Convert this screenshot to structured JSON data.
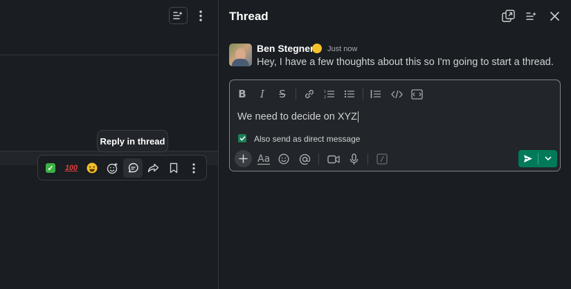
{
  "left_pane": {
    "tooltip": "Reply in thread",
    "actions": [
      {
        "name": "react-check-button",
        "icon": "white-check-mark-emoji"
      },
      {
        "name": "react-100-button",
        "icon": "hundred-points-emoji",
        "text": "100"
      },
      {
        "name": "react-laughing-button",
        "icon": "laughing-emoji"
      },
      {
        "name": "add-reaction-button",
        "icon": "add-reaction-icon"
      },
      {
        "name": "reply-in-thread-button",
        "icon": "reply-thread-icon"
      },
      {
        "name": "forward-message-button",
        "icon": "share-forward-icon"
      },
      {
        "name": "save-for-later-button",
        "icon": "bookmark-icon"
      },
      {
        "name": "more-actions-button",
        "icon": "more-vertical-icon"
      }
    ]
  },
  "thread": {
    "title": "Thread",
    "message": {
      "author": "Ben Stegner",
      "time": "Just now",
      "text": "Hey, I have a few thoughts about this so I'm going to start a thread."
    },
    "composer": {
      "text": "We need to decide on XYZ",
      "also_send_label": "Also send as direct message",
      "also_send_checked": true
    }
  },
  "colors": {
    "background": "#1a1d21",
    "send_button": "#007a5a",
    "checkbox": "#1c7f57",
    "border": "#35373b"
  }
}
